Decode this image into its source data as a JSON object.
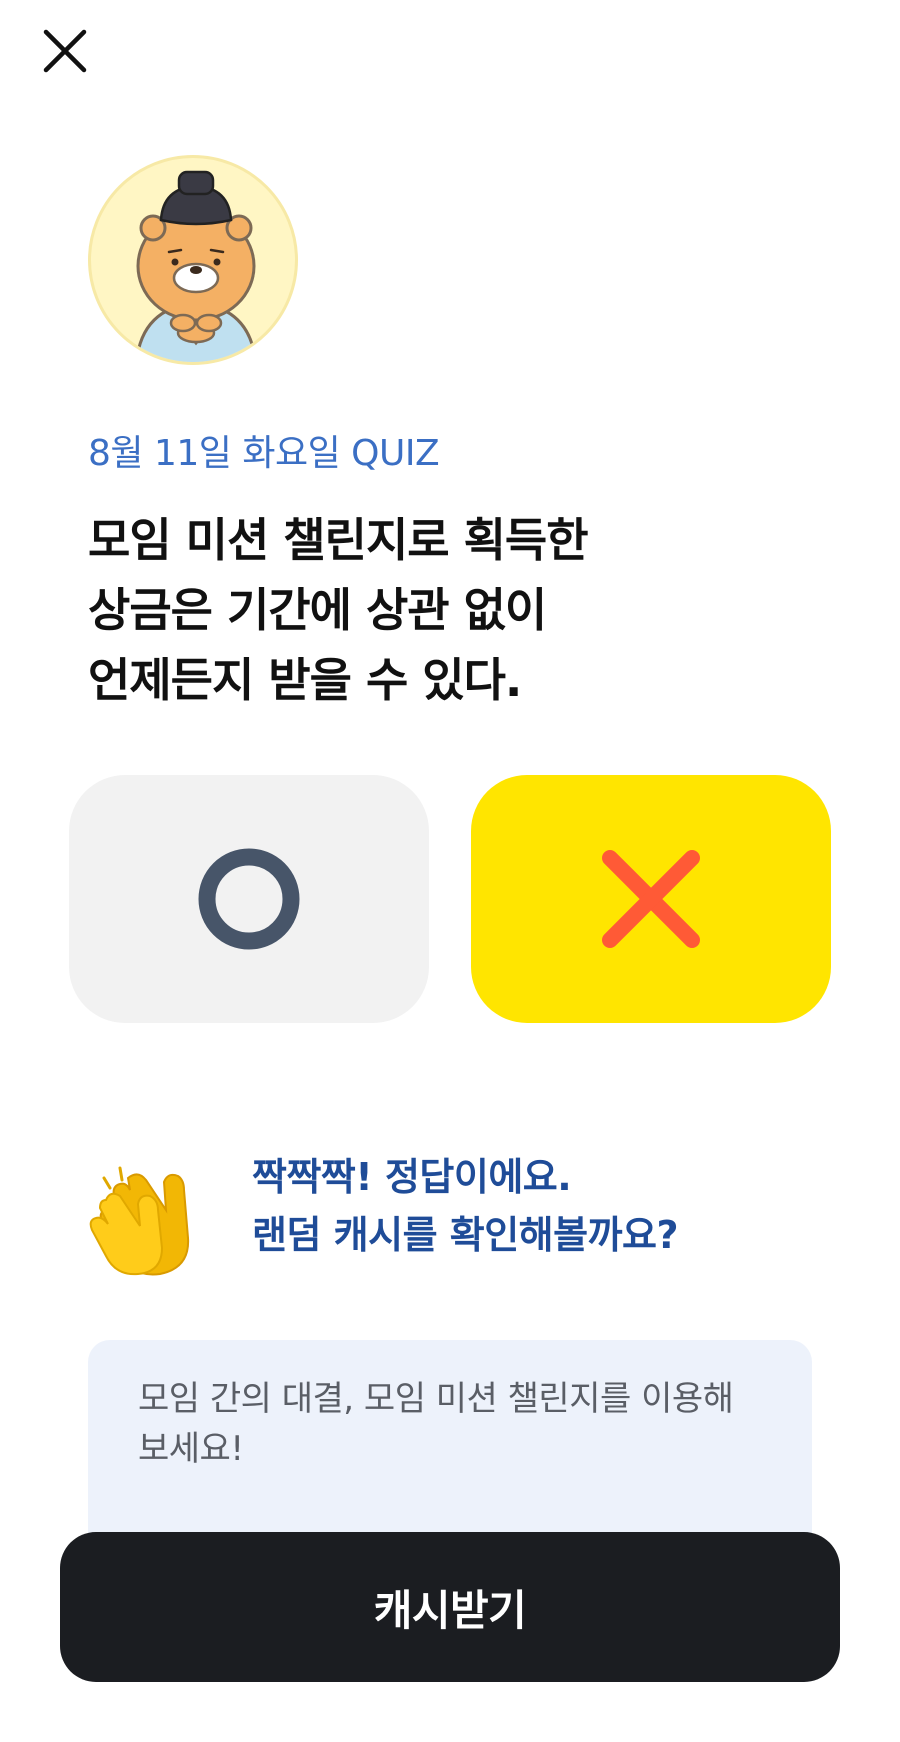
{
  "header": {
    "close_icon": "close-icon"
  },
  "profile": {
    "avatar_icon": "character-avatar"
  },
  "quiz": {
    "date_label": "8월 11일 화요일 QUIZ",
    "question_lines": [
      "모임 미션 챌린지로 획득한",
      "상금은 기간에 상관 없이",
      "언제든지 받을 수 있다."
    ]
  },
  "answers": {
    "o_icon": "circle-o-icon",
    "x_icon": "cross-x-icon",
    "selected": "X",
    "colors": {
      "o_bg": "#f2f2f2",
      "o_mark": "#475569",
      "x_bg": "#ffe500",
      "x_mark": "#ff5a36"
    }
  },
  "result": {
    "icon": "clapping-hands-icon",
    "lines": [
      "짝짝짝! 정답이에요.",
      "랜덤 캐시를 확인해볼까요?"
    ]
  },
  "hint": {
    "lines": [
      "모임 간의 대결, 모임 미션 챌린지를 이용해",
      "보세요!"
    ]
  },
  "footer": {
    "button_label": "캐시받기"
  }
}
